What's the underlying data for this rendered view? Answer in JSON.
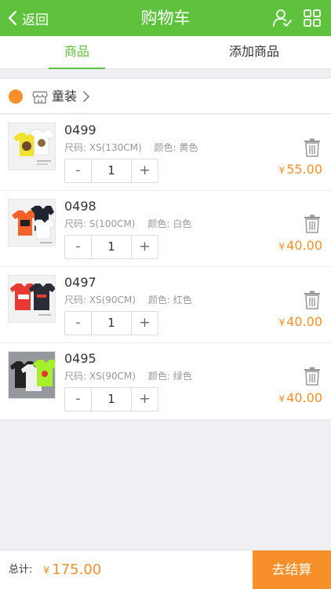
{
  "header": {
    "back_label": "返回",
    "title": "购物车",
    "right_icons": [
      "user-check-icon",
      "grid-icon"
    ],
    "color": "#5fc23c"
  },
  "tabs": [
    {
      "label": "商品",
      "active": true
    },
    {
      "label": "添加商品",
      "active": false
    }
  ],
  "shop": {
    "name": "童装",
    "selected": true,
    "accent": "#f7902a"
  },
  "items": [
    {
      "sku": "0499",
      "size_label": "尺码:",
      "size": "XS(130CM)",
      "color_label": "颜色:",
      "color": "黄色",
      "qty": "1",
      "currency": "¥",
      "price": "55.00",
      "minus": "-",
      "plus": "+"
    },
    {
      "sku": "0498",
      "size_label": "尺码:",
      "size": "S(100CM)",
      "color_label": "颜色:",
      "color": "白色",
      "qty": "1",
      "currency": "¥",
      "price": "40.00",
      "minus": "-",
      "plus": "+"
    },
    {
      "sku": "0497",
      "size_label": "尺码:",
      "size": "XS(90CM)",
      "color_label": "颜色:",
      "color": "红色",
      "qty": "1",
      "currency": "¥",
      "price": "40.00",
      "minus": "-",
      "plus": "+"
    },
    {
      "sku": "0495",
      "size_label": "尺码:",
      "size": "XS(90CM)",
      "color_label": "颜色:",
      "color": "绿色",
      "qty": "1",
      "currency": "¥",
      "price": "40.00",
      "minus": "-",
      "plus": "+"
    }
  ],
  "footer": {
    "total_label": "总计:",
    "currency": "¥",
    "total": "175.00",
    "checkout_label": "去结算"
  }
}
